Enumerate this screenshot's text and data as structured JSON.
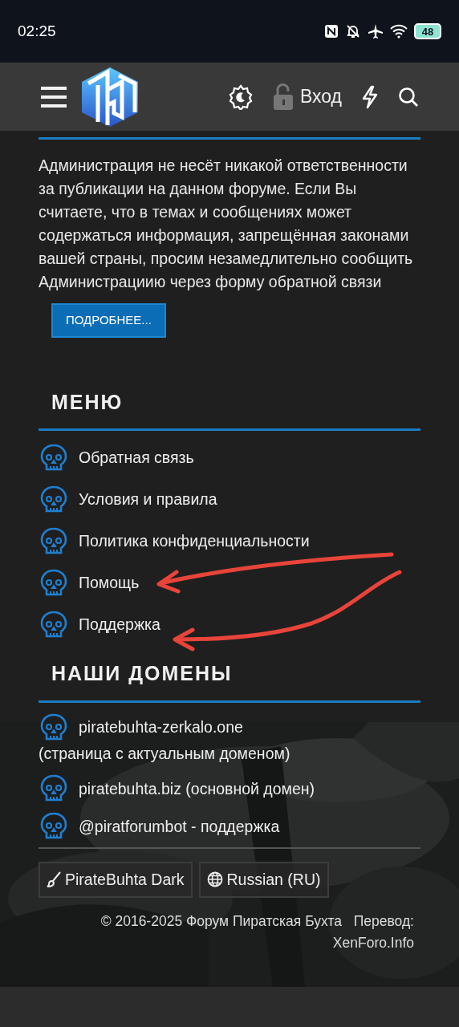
{
  "status_bar": {
    "time": "02:25",
    "battery": "48"
  },
  "header": {
    "login_label": "Вход"
  },
  "notice": {
    "text": "Администрация не несёт никакой ответственности за публикации на данном форуме. Если Вы считаете, что в темах и сообщениях может содержаться информация, запрещённая законами вашей страны, просим незамедлительно сообщить Администрациию через форму обратной связи",
    "button": "ПОДРОБНЕЕ..."
  },
  "menu": {
    "title": "МЕНЮ",
    "items": [
      {
        "label": "Обратная связь"
      },
      {
        "label": "Условия и правила"
      },
      {
        "label": "Политика конфиденциальности"
      },
      {
        "label": "Помощь"
      },
      {
        "label": "Поддержка"
      }
    ]
  },
  "domains": {
    "title": "НАШИ ДОМЕНЫ",
    "items": [
      {
        "label": "piratebuhta-zerkalo.one",
        "note": "(страница с актуальным доменом)"
      },
      {
        "label": "piratebuhta.biz (основной домен)"
      },
      {
        "label": "@piratforumbot - поддержка"
      }
    ]
  },
  "footer": {
    "style_button": "PirateBuhta Dark",
    "language_button": "Russian (RU)",
    "copyright": "© 2016-2025 Форум Пиратская Бухта",
    "translation_label": "Перевод:",
    "translation_link": "XenForo.Info"
  }
}
